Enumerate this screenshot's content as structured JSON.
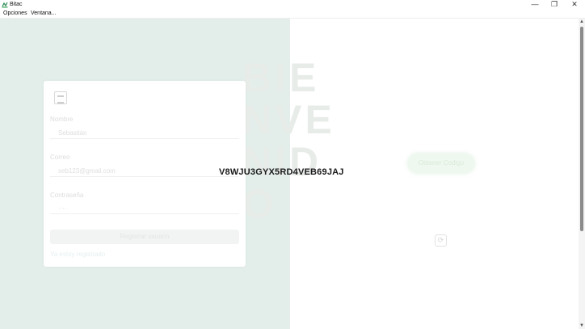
{
  "window": {
    "title": "Bitac",
    "minimize": "—",
    "maximize": "❐",
    "close": "✕"
  },
  "menu": {
    "items": [
      "Opciones",
      "Ventana..."
    ]
  },
  "background_word": "BIENVENIDO",
  "form": {
    "name_label": "Nombre",
    "name_value": "Sebastián",
    "email_label": "Correo",
    "email_value": "seb123@gmail.com",
    "password_label": "Contraseña",
    "password_value": "····",
    "register_button": "Registrar usuario",
    "login_link": "Ya estoy registrado"
  },
  "code": {
    "value": "V8WJU3GYX5RD4VEB69JAJ"
  },
  "right": {
    "obtain_button": "Obtener Codigo",
    "refresh_symbol": "⟳"
  },
  "scrollbar": {
    "up": "▲",
    "down": "▼"
  },
  "colors": {
    "left_bg": "#e3eeeb",
    "card_bg": "#ffffff",
    "accent_green": "#dbead9"
  }
}
